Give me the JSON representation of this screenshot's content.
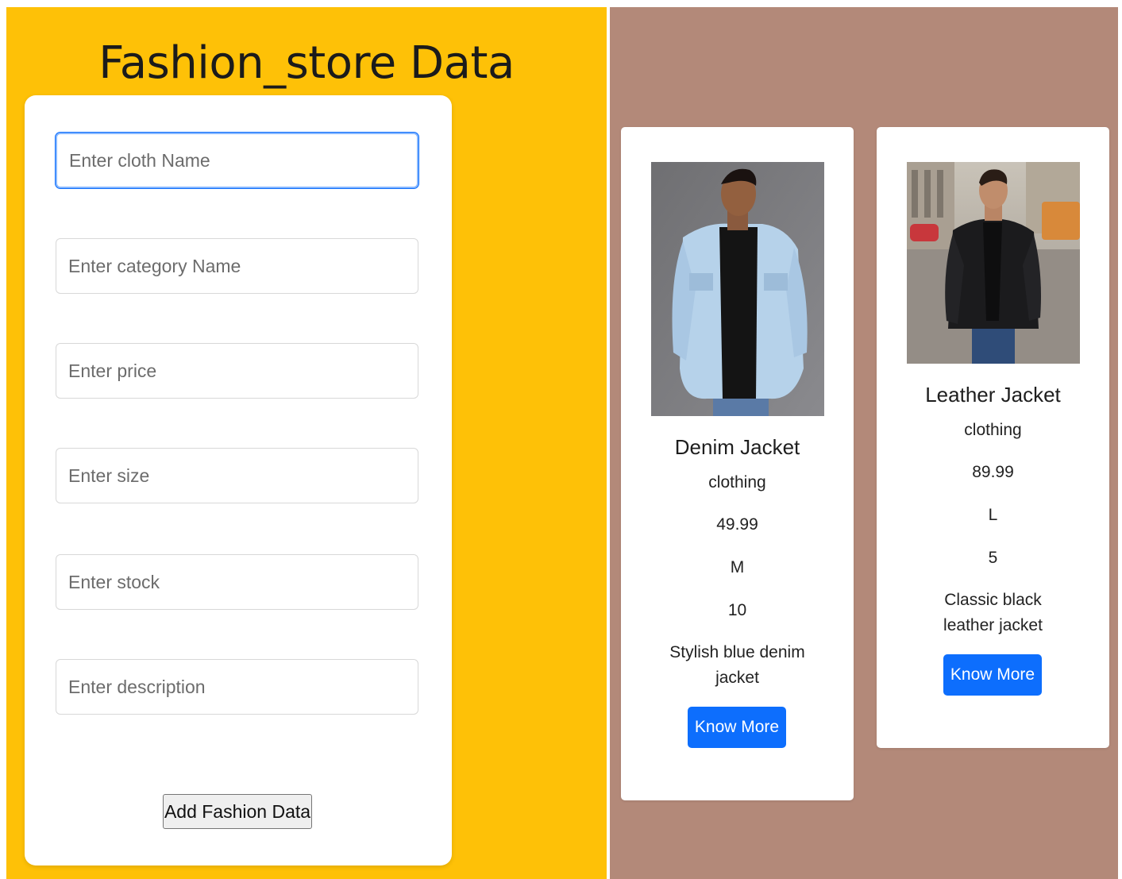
{
  "page_title": "Fashion_store Data",
  "colors": {
    "left_bg": "#fec107",
    "right_bg": "#b38979",
    "primary_button": "#0d6efd"
  },
  "form": {
    "fields": [
      {
        "placeholder": "Enter cloth Name",
        "value": "",
        "focused": true
      },
      {
        "placeholder": "Enter category Name",
        "value": ""
      },
      {
        "placeholder": "Enter price",
        "value": ""
      },
      {
        "placeholder": "Enter size",
        "value": ""
      },
      {
        "placeholder": "Enter stock",
        "value": ""
      },
      {
        "placeholder": "Enter description",
        "value": ""
      }
    ],
    "submit_label": "Add Fashion Data"
  },
  "products": [
    {
      "image": "photo-man-in-denim-jacket",
      "name": "Denim Jacket",
      "category": "clothing",
      "price": "49.99",
      "size": "M",
      "stock": "10",
      "description": "Stylish blue denim jacket",
      "button_label": "Know More"
    },
    {
      "image": "photo-man-in-black-leather-jacket-street",
      "name": "Leather Jacket",
      "category": "clothing",
      "price": "89.99",
      "size": "L",
      "stock": "5",
      "description": "Classic black leather jacket",
      "button_label": "Know More"
    }
  ]
}
